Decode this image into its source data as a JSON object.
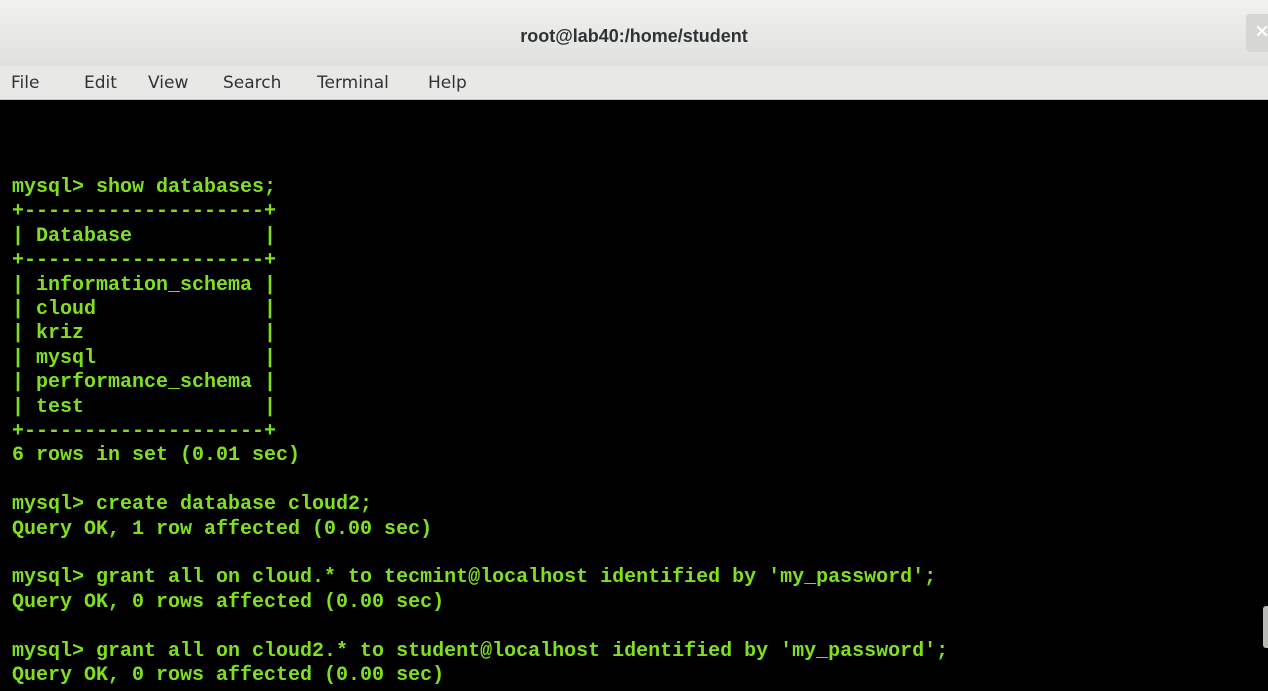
{
  "window": {
    "title": "root@lab40:/home/student"
  },
  "menu": {
    "items": [
      {
        "label": "File"
      },
      {
        "label": "Edit"
      },
      {
        "label": "View"
      },
      {
        "label": "Search"
      },
      {
        "label": "Terminal"
      },
      {
        "label": "Help"
      }
    ]
  },
  "terminal": {
    "colors": {
      "text": "#7fe01f",
      "background": "#000000"
    },
    "lines": [
      "mysql> show databases;",
      "+--------------------+",
      "| Database           |",
      "+--------------------+",
      "| information_schema |",
      "| cloud              |",
      "| kriz               |",
      "| mysql              |",
      "| performance_schema |",
      "| test               |",
      "+--------------------+",
      "6 rows in set (0.01 sec)",
      "",
      "mysql> create database cloud2;",
      "Query OK, 1 row affected (0.00 sec)",
      "",
      "mysql> grant all on cloud.* to tecmint@localhost identified by 'my_password';",
      "Query OK, 0 rows affected (0.00 sec)",
      "",
      "mysql> grant all on cloud2.* to student@localhost identified by 'my_password';",
      "Query OK, 0 rows affected (0.00 sec)"
    ]
  }
}
